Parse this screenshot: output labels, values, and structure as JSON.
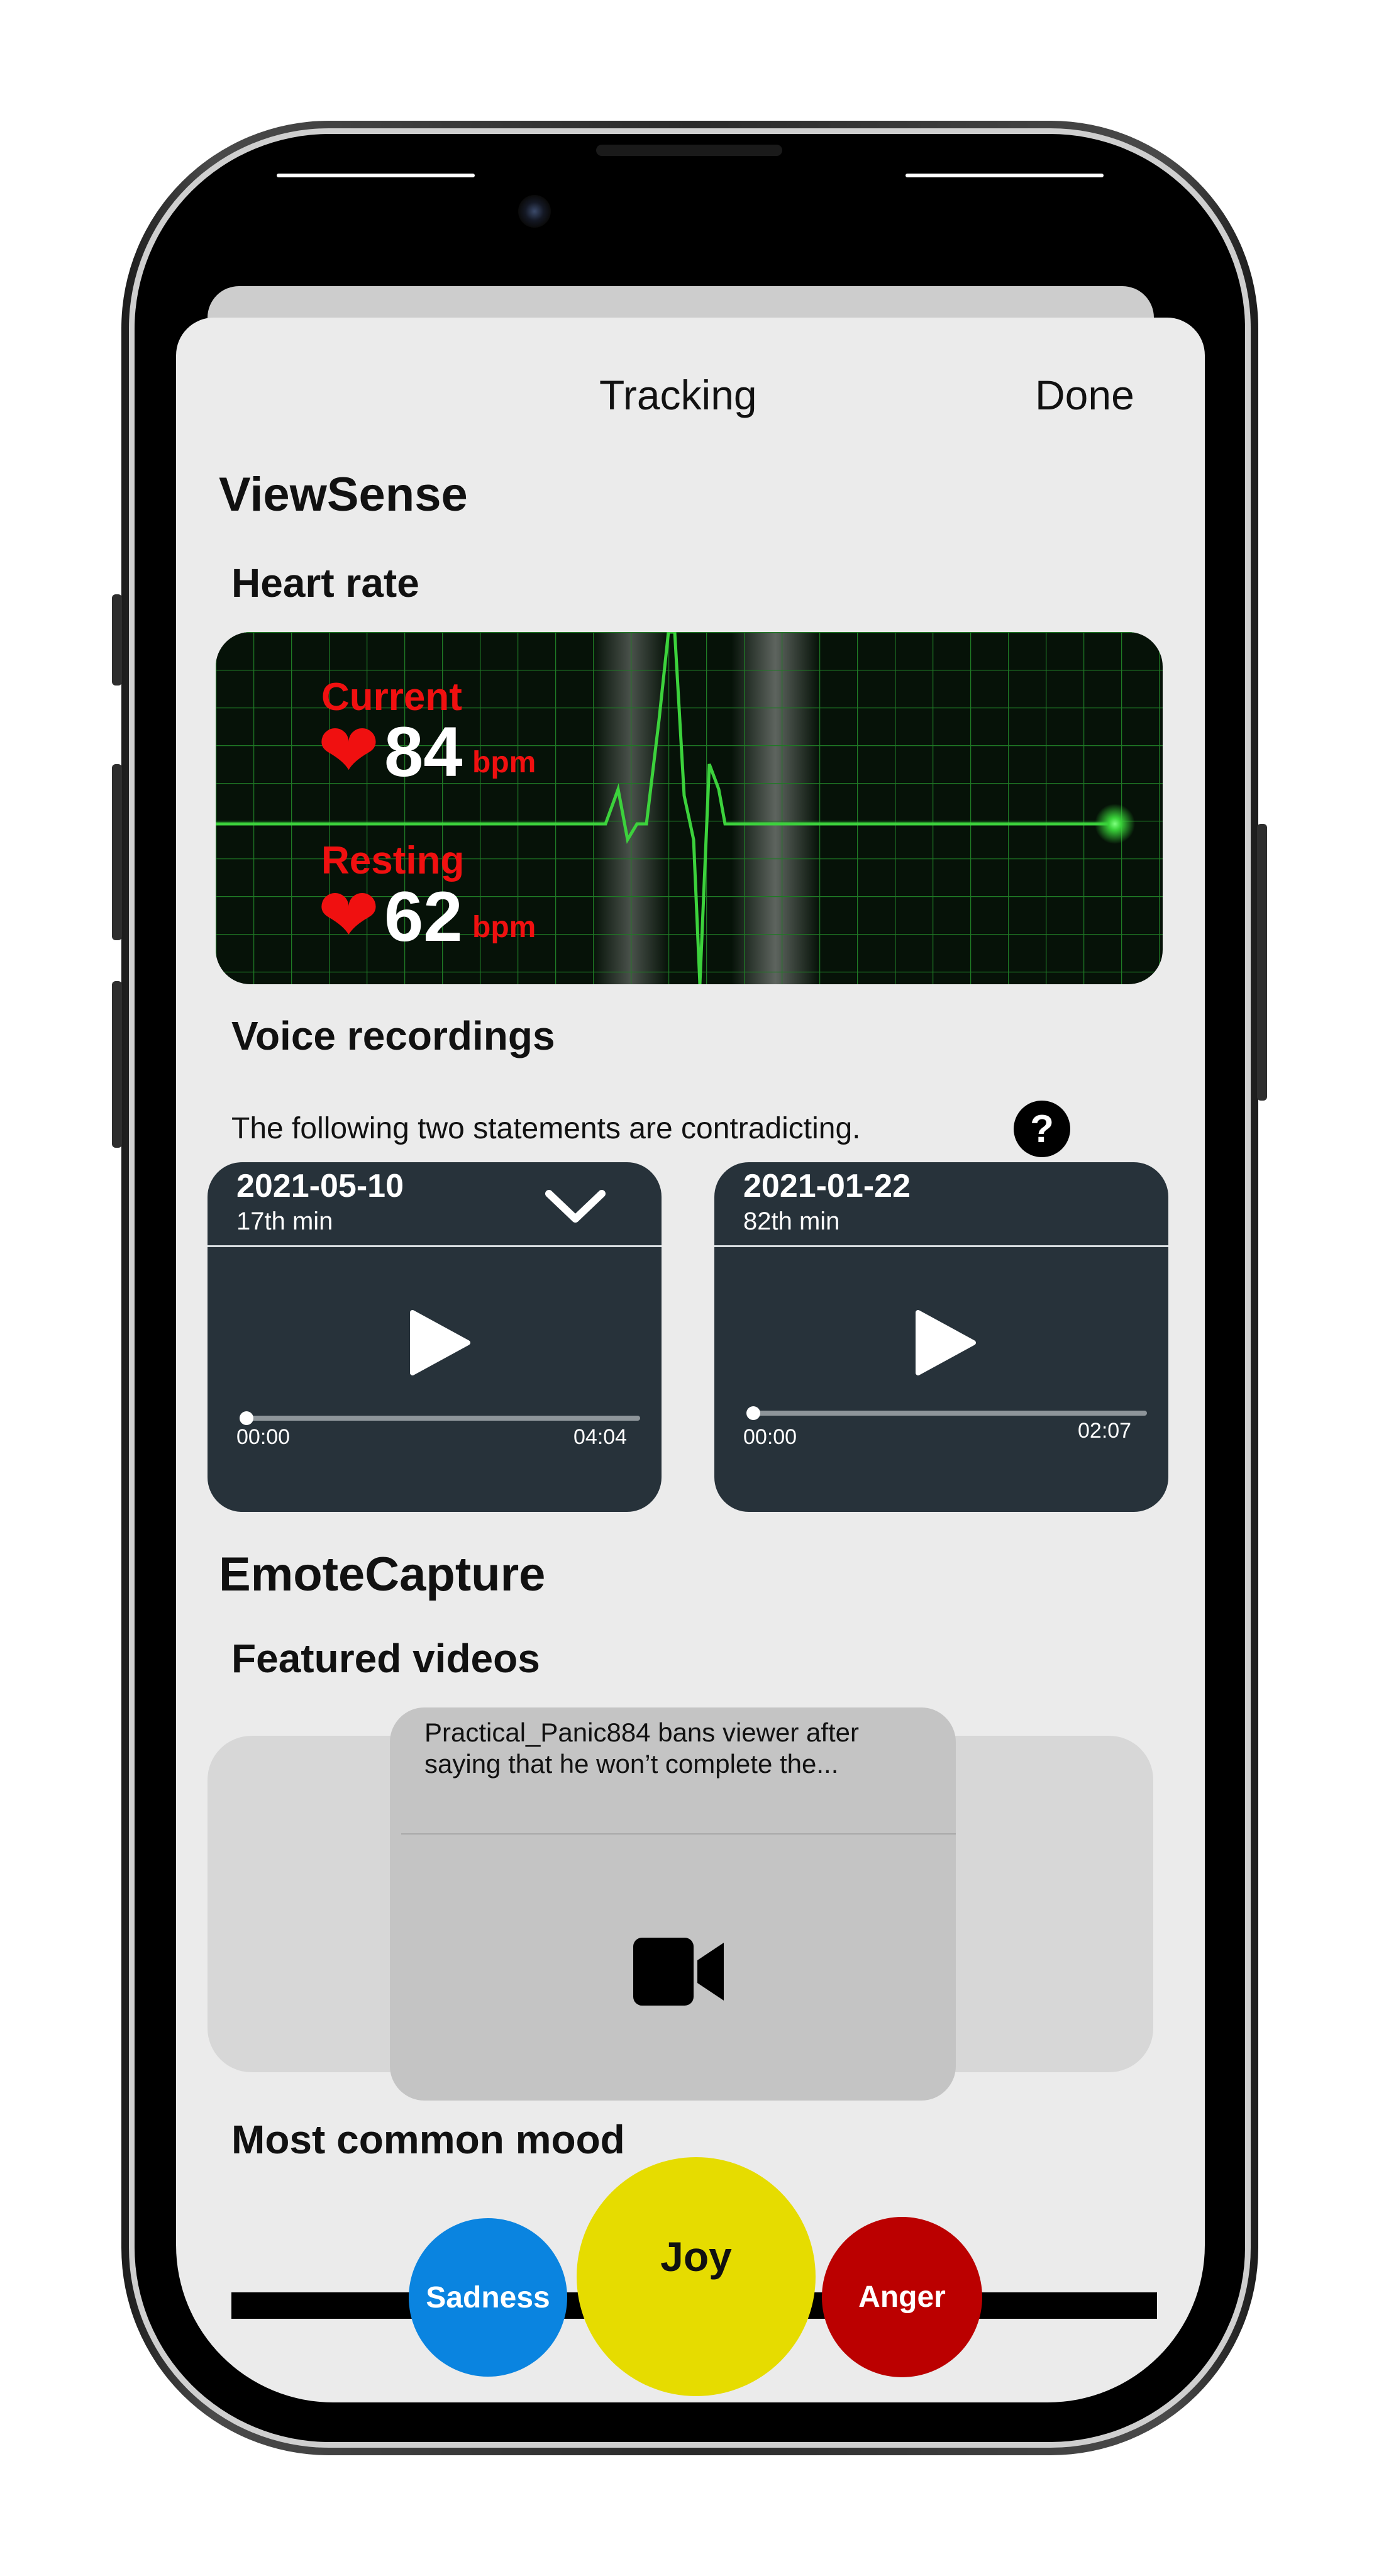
{
  "nav": {
    "title": "Tracking",
    "done_label": "Done"
  },
  "viewsense": {
    "section_title": "ViewSense",
    "heart_rate": {
      "title": "Heart rate",
      "current_label": "Current",
      "current_value": "84",
      "resting_label": "Resting",
      "resting_value": "62",
      "unit": "bpm",
      "heart_glyph": "❤"
    },
    "voice": {
      "title": "Voice recordings",
      "description": "The following two statements are contradicting.",
      "help_icon": "?",
      "recordings": [
        {
          "date": "2021-05-10",
          "minute": "17th min",
          "elapsed": "00:00",
          "duration": "04:04",
          "progress": 0
        },
        {
          "date": "2021-01-22",
          "minute": "82th min",
          "elapsed": "00:00",
          "duration": "02:07",
          "progress": 0
        }
      ]
    }
  },
  "emotecapture": {
    "section_title": "EmoteCapture",
    "featured": {
      "title": "Featured videos",
      "video_title": "Practical_Panic884 bans viewer after saying that he won’t complete the..."
    },
    "mood": {
      "title": "Most common mood",
      "moods": [
        {
          "label": "Sadness",
          "color": "#0a84e0"
        },
        {
          "label": "Joy",
          "color": "#e6dc00"
        },
        {
          "label": "Anger",
          "color": "#bb0000"
        }
      ]
    }
  },
  "colors": {
    "ecg_green": "#3cd23c",
    "hr_red": "#f01010",
    "card_dark": "#27323a"
  }
}
